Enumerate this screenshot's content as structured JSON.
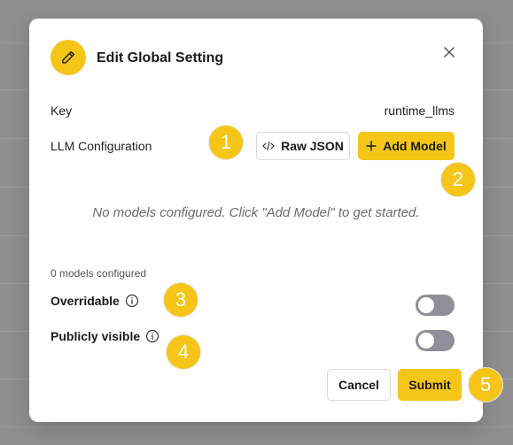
{
  "dialog": {
    "title": "Edit Global Setting",
    "header_icon": "pencil-icon",
    "close_icon": "close-icon"
  },
  "fields": {
    "key_label": "Key",
    "key_value": "runtime_llms",
    "llm_label": "LLM Configuration"
  },
  "buttons": {
    "raw_json": "Raw JSON",
    "raw_json_icon": "code-icon",
    "add_model": "Add Model",
    "add_model_icon": "plus-icon",
    "cancel": "Cancel",
    "submit": "Submit"
  },
  "empty_state": "No models configured. Click \"Add Model\" to get started.",
  "models_count_text": "0 models configured",
  "toggles": [
    {
      "label": "Overridable",
      "on": false
    },
    {
      "label": "Publicly visible",
      "on": false
    }
  ],
  "markers": [
    "1",
    "2",
    "3",
    "4",
    "5"
  ],
  "colors": {
    "accent": "#f5c518",
    "toggle_off": "#8f8f99",
    "backdrop": "#8f8f8f"
  }
}
